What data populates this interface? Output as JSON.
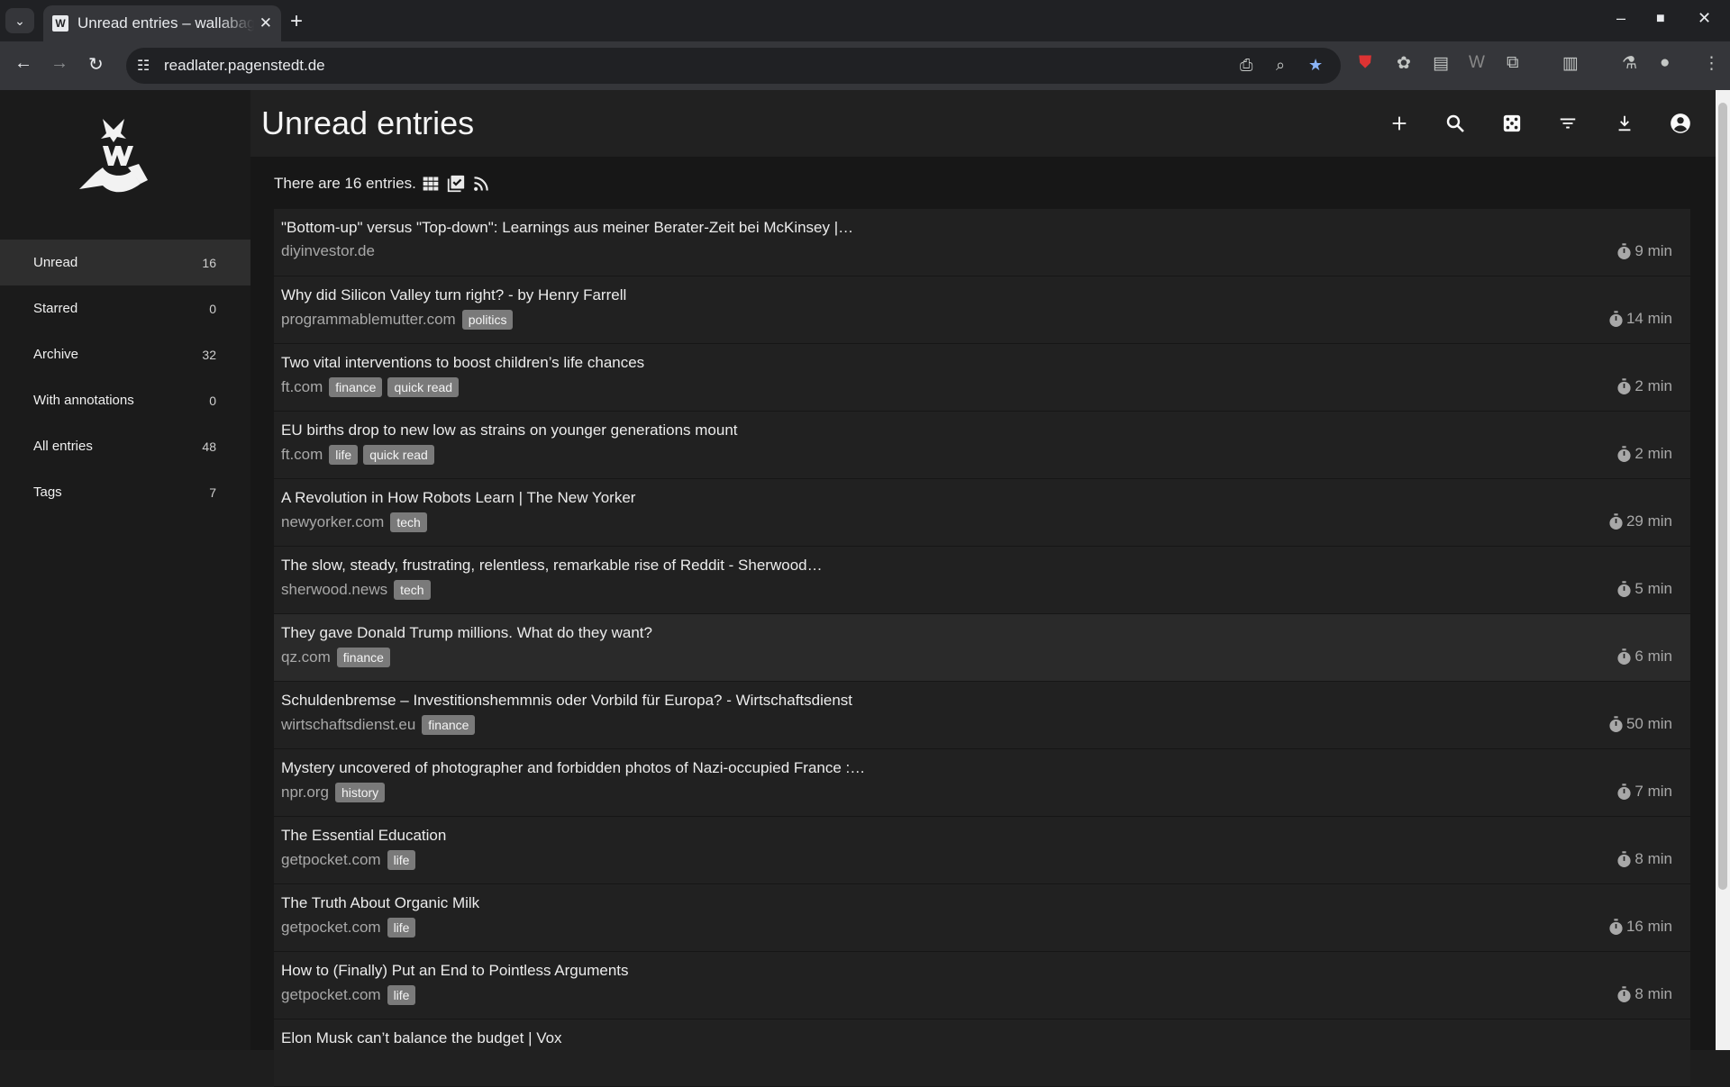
{
  "browser": {
    "tab_title": "Unread entries – wallabag",
    "favicon_letter": "W",
    "url": "readlater.pagenstedt.de",
    "new_tab": "+",
    "close_tab": "✕"
  },
  "app": {
    "page_title": "Unread entries",
    "entries_text": "There are 16 entries.",
    "sidebar": {
      "items": [
        {
          "label": "Unread",
          "count": "16"
        },
        {
          "label": "Starred",
          "count": "0"
        },
        {
          "label": "Archive",
          "count": "32"
        },
        {
          "label": "With annotations",
          "count": "0"
        },
        {
          "label": "All entries",
          "count": "48"
        },
        {
          "label": "Tags",
          "count": "7"
        }
      ]
    },
    "entries": [
      {
        "title": "\"Bottom-up\" versus \"Top-down\": Learnings aus meiner Berater-Zeit bei McKinsey |…",
        "domain": "diyinvestor.de",
        "tags": [],
        "time": "9 min"
      },
      {
        "title": "Why did Silicon Valley turn right? - by Henry Farrell",
        "domain": "programmablemutter.com",
        "tags": [
          "politics"
        ],
        "time": "14 min"
      },
      {
        "title": "Two vital interventions to boost children’s life chances",
        "domain": "ft.com",
        "tags": [
          "finance",
          "quick read"
        ],
        "time": "2 min"
      },
      {
        "title": "EU births drop to new low as strains on younger generations mount",
        "domain": "ft.com",
        "tags": [
          "life",
          "quick read"
        ],
        "time": "2 min"
      },
      {
        "title": "A Revolution in How Robots Learn | The New Yorker",
        "domain": "newyorker.com",
        "tags": [
          "tech"
        ],
        "time": "29 min"
      },
      {
        "title": "The slow, steady, frustrating, relentless, remarkable rise of Reddit - Sherwood…",
        "domain": "sherwood.news",
        "tags": [
          "tech"
        ],
        "time": "5 min"
      },
      {
        "title": "They gave Donald Trump millions. What do they want?",
        "domain": "qz.com",
        "tags": [
          "finance"
        ],
        "time": "6 min"
      },
      {
        "title": "Schuldenbremse – Investitionshemmnis oder Vorbild für Europa? - Wirtschaftsdienst",
        "domain": "wirtschaftsdienst.eu",
        "tags": [
          "finance"
        ],
        "time": "50 min"
      },
      {
        "title": "Mystery uncovered of photographer and forbidden photos of Nazi-occupied France :…",
        "domain": "npr.org",
        "tags": [
          "history"
        ],
        "time": "7 min"
      },
      {
        "title": "The Essential Education",
        "domain": "getpocket.com",
        "tags": [
          "life"
        ],
        "time": "8 min"
      },
      {
        "title": "The Truth About Organic Milk",
        "domain": "getpocket.com",
        "tags": [
          "life"
        ],
        "time": "16 min"
      },
      {
        "title": "How to (Finally) Put an End to Pointless Arguments",
        "domain": "getpocket.com",
        "tags": [
          "life"
        ],
        "time": "8 min"
      },
      {
        "title": "Elon Musk can’t balance the budget | Vox",
        "domain": "",
        "tags": [],
        "time": ""
      }
    ]
  }
}
